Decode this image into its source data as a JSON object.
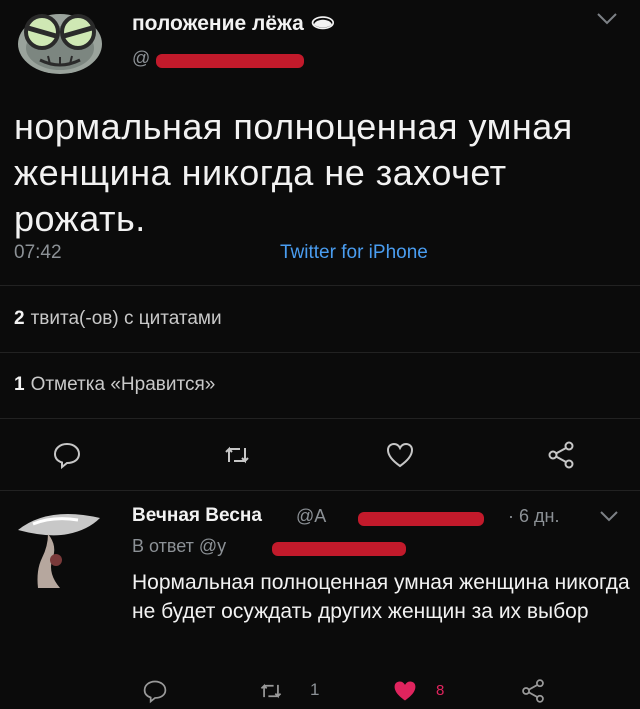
{
  "tweet": {
    "author_name": "положение лёжа 🕳",
    "handle_prefix": "@",
    "text": "нормальная полноценная умная женщина никогда не захочет рожать.",
    "time": "07:42",
    "source": "Twitter for iPhone",
    "quotes": {
      "count": "2",
      "label": "твита(-ов) с цитатами"
    },
    "likes": {
      "count": "1",
      "label": "Отметка «Нравится»"
    },
    "actions": [
      "reply-icon",
      "retweet-icon",
      "like-icon",
      "share-icon"
    ]
  },
  "reply": {
    "author_name": "Вечная Весна",
    "handle_prefix": "@A",
    "time": "· 6 дн.",
    "reply_to_label": "В ответ @y",
    "text": "Нормальная полноценная умная женщина никогда не будет осуждать других женщин за их выбор",
    "retweet_count": "1",
    "like_count": "8"
  },
  "colors": {
    "background": "#0b0b0b",
    "link": "#4a9df0",
    "like": "#e0245e",
    "redaction": "#c21a2b",
    "muted": "#8c9196"
  }
}
